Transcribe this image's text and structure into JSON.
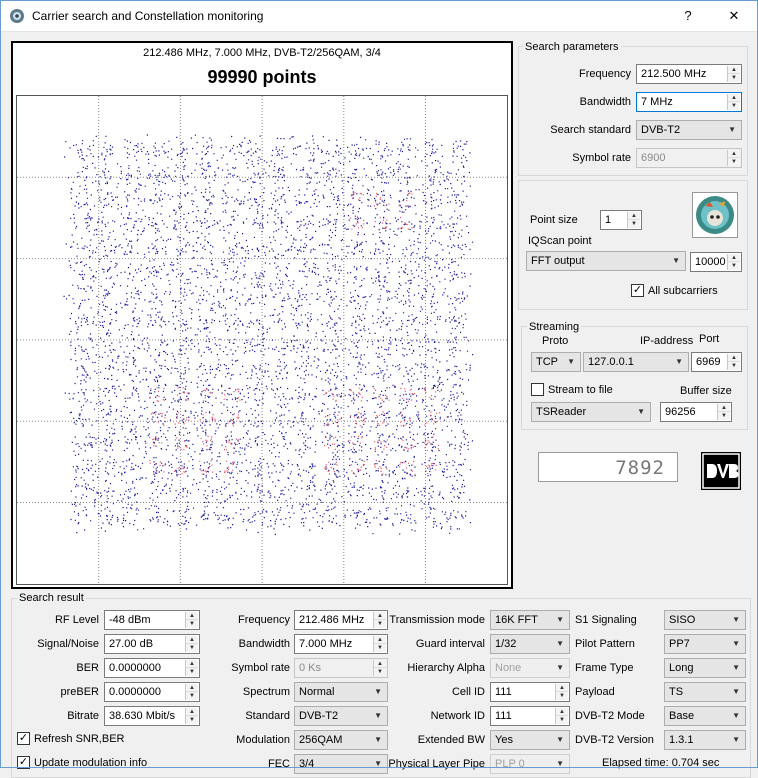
{
  "window": {
    "title": "Carrier search and Constellation monitoring",
    "help_label": "?",
    "close_label": "✕"
  },
  "plot": {
    "info": "212.486 MHz, 7.000 MHz, DVB-T2/256QAM, 3/4",
    "points": "99990 points"
  },
  "search_params": {
    "title": "Search parameters",
    "frequency_label": "Frequency",
    "frequency_value": "212.500 MHz",
    "bandwidth_label": "Bandwidth",
    "bandwidth_value": "7 MHz",
    "standard_label": "Search standard",
    "standard_value": "DVB-T2",
    "symbol_rate_label": "Symbol rate",
    "symbol_rate_value": "6900"
  },
  "display": {
    "point_size_label": "Point size",
    "point_size_value": "1",
    "iqscan_label": "IQScan point",
    "iqscan_value": "FFT output",
    "iqscan_count": "10000",
    "all_subcarriers_label": "All subcarriers",
    "all_subcarriers_checked": true
  },
  "streaming": {
    "title": "Streaming",
    "proto_label": "Proto",
    "ip_label": "IP-address",
    "port_label": "Port",
    "proto_value": "TCP",
    "ip_value": "127.0.0.1",
    "port_value": "6969",
    "stream_to_file_label": "Stream to file",
    "stream_to_file_checked": false,
    "buffer_label": "Buffer size",
    "reader_value": "TSReader",
    "buffer_value": "96256"
  },
  "lcd_value": "7892",
  "search_result": {
    "title": "Search result",
    "col1": [
      {
        "label": "RF Level",
        "value": "-48 dBm"
      },
      {
        "label": "Signal/Noise",
        "value": "27.00 dB"
      },
      {
        "label": "BER",
        "value": "0.0000000"
      },
      {
        "label": "preBER",
        "value": "0.0000000"
      },
      {
        "label": "Bitrate",
        "value": "38.630 Mbit/s"
      }
    ],
    "refresh_label": "Refresh SNR,BER",
    "update_label": "Update modulation info",
    "col2": [
      {
        "label": "Frequency",
        "value": "212.486 MHz"
      },
      {
        "label": "Bandwidth",
        "value": "7.000 MHz"
      },
      {
        "label": "Symbol rate",
        "value": "0 Ks"
      },
      {
        "label": "Spectrum",
        "value": "Normal"
      },
      {
        "label": "Standard",
        "value": "DVB-T2"
      },
      {
        "label": "Modulation",
        "value": "256QAM"
      },
      {
        "label": "FEC",
        "value": "3/4"
      }
    ],
    "col3": [
      {
        "label": "Transmission mode",
        "value": "16K FFT"
      },
      {
        "label": "Guard interval",
        "value": "1/32"
      },
      {
        "label": "Hierarchy Alpha",
        "value": "None"
      },
      {
        "label": "Cell ID",
        "value": "111"
      },
      {
        "label": "Network ID",
        "value": "111"
      },
      {
        "label": "Extended BW",
        "value": "Yes"
      },
      {
        "label": "Physical Layer Pipe",
        "value": "PLP 0"
      }
    ],
    "col4": [
      {
        "label": "S1 Signaling",
        "value": "SISO"
      },
      {
        "label": "Pilot Pattern",
        "value": "PP7"
      },
      {
        "label": "Frame Type",
        "value": "Long"
      },
      {
        "label": "Payload",
        "value": "TS"
      },
      {
        "label": "DVB-T2 Mode",
        "value": "Base"
      },
      {
        "label": "DVB-T2 Version",
        "value": "1.3.1"
      }
    ],
    "elapsed": "Elapsed time: 0.704 sec"
  },
  "colors": {
    "accent": "#0078d7",
    "points": "#1a1aa0",
    "dense_points": "#e0203a"
  }
}
